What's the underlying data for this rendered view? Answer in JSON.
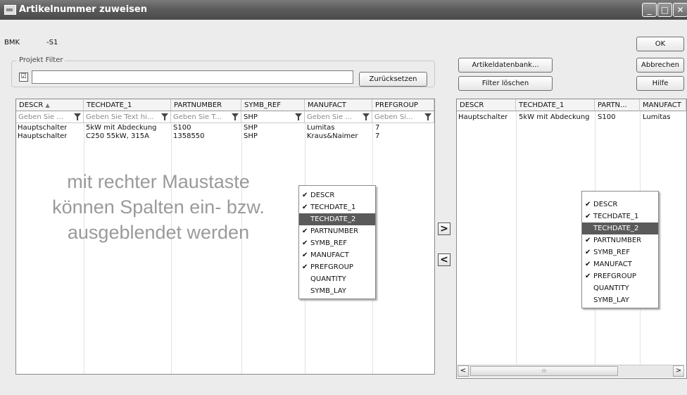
{
  "window": {
    "title": "Artikelnummer zuweisen",
    "min": "_",
    "max": "□",
    "close": "✕"
  },
  "bmk": {
    "label": "BMK",
    "value": "-S1"
  },
  "filter": {
    "group_label": "Projekt Filter",
    "checkbox_checked": "☑",
    "text": "",
    "reset_label": "Zurücksetzen"
  },
  "buttons": {
    "article_db": "Artikeldatenbank...",
    "clear_filter": "Filter löschen",
    "ok": "OK",
    "cancel": "Abbrechen",
    "help": "Hilfe",
    "move_right": ">",
    "move_left": "<"
  },
  "left_grid": {
    "columns": [
      "DESCR",
      "TECHDATE_1",
      "PARTNUMBER",
      "SYMB_REF",
      "MANUFACT",
      "PREFGROUP"
    ],
    "sort_indicator": "▲",
    "filters": [
      "Geben Sie ...",
      "Geben Sie Text hi...",
      "Geben Sie T...",
      "SHP",
      "Geben Sie ...",
      "Geben Si..."
    ],
    "rows": [
      [
        "Hauptschalter",
        "5kW mit Abdeckung",
        "S100",
        "SHP",
        "Lumitas",
        "7"
      ],
      [
        "Hauptschalter",
        "C250 55kW, 315A",
        "1358550",
        "SHP",
        "Kraus&Naimer",
        "7"
      ]
    ]
  },
  "watermark": {
    "line1": "mit rechter Maustaste",
    "line2": "können Spalten ein- bzw.",
    "line3": "ausgeblendet werden"
  },
  "column_menu": {
    "items": [
      {
        "label": "DESCR",
        "checked": "✔"
      },
      {
        "label": "TECHDATE_1",
        "checked": "✔"
      },
      {
        "label": "TECHDATE_2",
        "checked": ""
      },
      {
        "label": "PARTNUMBER",
        "checked": "✔"
      },
      {
        "label": "SYMB_REF",
        "checked": "✔"
      },
      {
        "label": "MANUFACT",
        "checked": "✔"
      },
      {
        "label": "PREFGROUP",
        "checked": "✔"
      },
      {
        "label": "QUANTITY",
        "checked": ""
      },
      {
        "label": "SYMB_LAY",
        "checked": ""
      }
    ]
  },
  "right_grid": {
    "columns": [
      "DESCR",
      "TECHDATE_1",
      "PARTN...",
      "MANUFACT"
    ],
    "rows": [
      [
        "Hauptschalter",
        "5kW mit Abdeckung",
        "S100",
        "Lumitas"
      ]
    ]
  },
  "scroll": {
    "left": "<",
    "right": ">",
    "grip": "III"
  }
}
